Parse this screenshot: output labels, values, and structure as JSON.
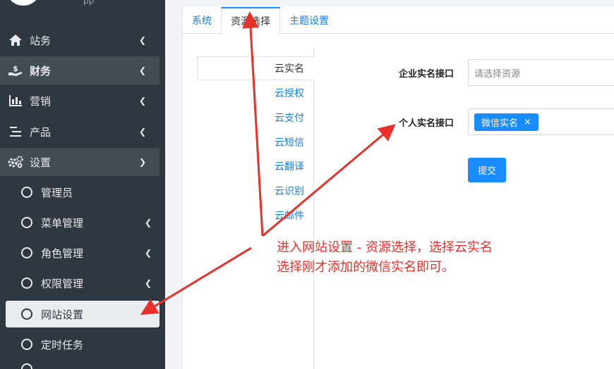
{
  "sidebar": {
    "app_name": "pp",
    "items": [
      {
        "label": "站务",
        "icon": "home-icon"
      },
      {
        "label": "财务",
        "icon": "money-hand-icon"
      },
      {
        "label": "营销",
        "icon": "bar-chart-icon"
      },
      {
        "label": "产品",
        "icon": "list-icon"
      },
      {
        "label": "设置",
        "icon": "gears-icon"
      }
    ],
    "sub_items": [
      {
        "label": "管理员"
      },
      {
        "label": "菜单管理"
      },
      {
        "label": "角色管理"
      },
      {
        "label": "权限管理"
      },
      {
        "label": "网站设置"
      },
      {
        "label": "定时任务"
      }
    ]
  },
  "tabs": [
    {
      "label": "系统"
    },
    {
      "label": "资源选择"
    },
    {
      "label": "主题设置"
    }
  ],
  "vnav": [
    {
      "label": "云实名"
    },
    {
      "label": "云授权"
    },
    {
      "label": "云支付"
    },
    {
      "label": "云短信"
    },
    {
      "label": "云翻译"
    },
    {
      "label": "云识别"
    },
    {
      "label": "云邮件"
    }
  ],
  "form": {
    "enterprise_label": "企业实名接口",
    "enterprise_placeholder": "请选择资源",
    "personal_label": "个人实名接口",
    "personal_tag": "微信实名",
    "tag_remove": "×",
    "submit_label": "提交"
  },
  "annotation": {
    "line1": "进入网站设置 - 资源选择，选择云实名",
    "line2": "选择刚才添加的微信实名即可。"
  },
  "colors": {
    "sidebar_bg": "#2f3740",
    "accent": "#1a8cff",
    "annotation": "#e8312b"
  }
}
